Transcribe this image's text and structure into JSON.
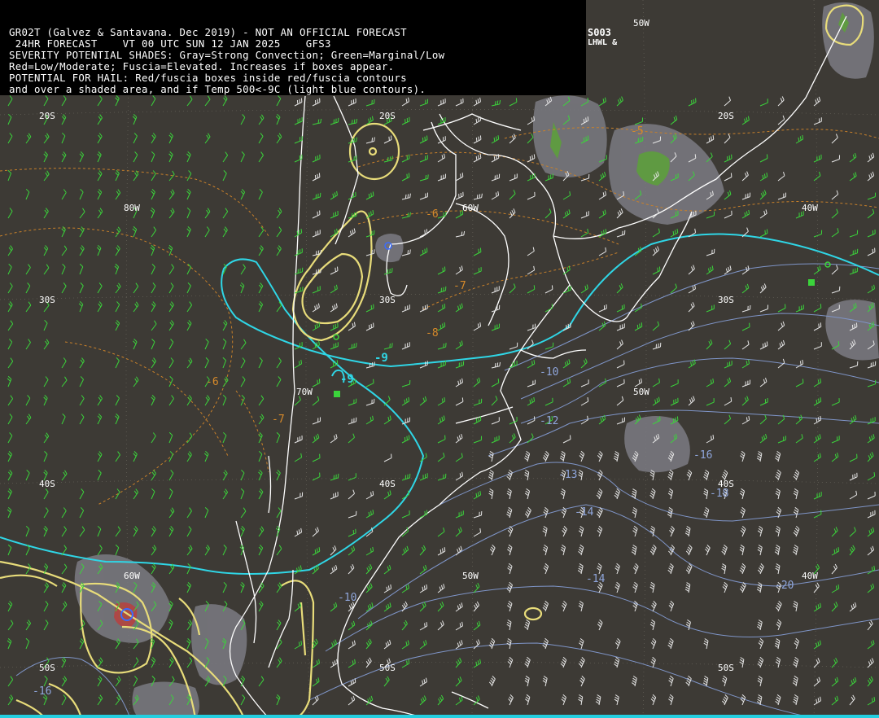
{
  "header": {
    "line1": "GR02T (Galvez & Santavana. Dec 2019) - NOT AN OFFICIAL FORECAST",
    "line2": " 24HR FORECAST    VT 00 UTC SUN 12 JAN 2025    GFS3",
    "line3": "SEVERITY POTENTIAL SHADES: Gray=Strong Convection; Green=Marginal/Low",
    "line4": "Red=Low/Moderate; Fuscia=Elevated. Increases if boxes appear.",
    "line5": "POTENTIAL FOR HAIL: Red/fuscia boxes inside red/fuscia contours",
    "line6": "and over a shaded area, and if Temp 500<-9C (light blue contours)."
  },
  "model_tag": "S003",
  "model_tag2": "LHWL &",
  "latlon_labels": {
    "l20s_a": "20S",
    "l20s_b": "20S",
    "l20s_c": "20S",
    "l30s_a": "30S",
    "l30s_b": "30S",
    "l30s_c": "30S",
    "l40s_a": "40S",
    "l40s_b": "40S",
    "l40s_c": "40S",
    "l50s_a": "50S",
    "l50s_b": "50S",
    "l50s_c": "50S",
    "l80w": "80W",
    "l60w": "60W",
    "l40w_a": "40W",
    "l40w_b": "40W",
    "l50w_a": "50W",
    "l50w_b": "50W",
    "l50w_c": "50W",
    "l70w": "70W",
    "l60w_b": "60W"
  },
  "orange_labels": {
    "o5": "-5",
    "o6a": "-6",
    "o7": "-7",
    "o8": "-8",
    "o6b": "-6",
    "o7b": "-7"
  },
  "cyan_labels": {
    "c9a": "-9",
    "c9b": "-9"
  },
  "blue_labels": {
    "b10": "-10",
    "b12": "-12",
    "b13": "-13",
    "b14": "-14",
    "b16": "-16",
    "b18": "-18",
    "b20": "-20",
    "b14b": "-14",
    "b10b": "-10",
    "b16b": "-16"
  },
  "colors": {
    "background": "#3d3a35",
    "coast": "#ffffff",
    "temp_500_cold": "#2fd6e6",
    "temp_contours": "#7f95c8",
    "thickness": "#c8802a",
    "hail_potential": "#e8dc7a",
    "wind_green": "#3bd43b",
    "wind_white": "#e6e6e6",
    "gray_shade": "#7a7a80",
    "green_shade": "#5f9a42",
    "red_shade": "#c04040"
  }
}
